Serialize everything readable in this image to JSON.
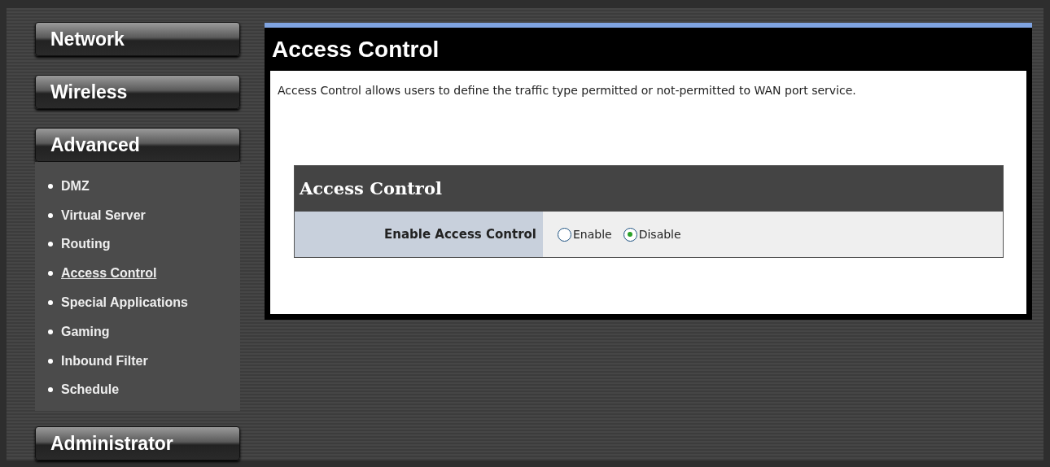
{
  "sidebar": {
    "sections": [
      {
        "label": "Network"
      },
      {
        "label": "Wireless"
      },
      {
        "label": "Advanced",
        "items": [
          {
            "label": "DMZ",
            "selected": false
          },
          {
            "label": "Virtual Server",
            "selected": false
          },
          {
            "label": "Routing",
            "selected": false
          },
          {
            "label": "Access Control",
            "selected": true
          },
          {
            "label": "Special Applications",
            "selected": false
          },
          {
            "label": "Gaming",
            "selected": false
          },
          {
            "label": "Inbound Filter",
            "selected": false
          },
          {
            "label": "Schedule",
            "selected": false
          }
        ]
      },
      {
        "label": "Administrator"
      }
    ]
  },
  "main": {
    "title": "Access Control",
    "description": "Access Control allows users to define the traffic type permitted or not-permitted to WAN port service.",
    "table": {
      "header": "Access Control",
      "rows": [
        {
          "label": "Enable Access Control",
          "options": [
            {
              "label": "Enable",
              "selected": false
            },
            {
              "label": "Disable",
              "selected": true
            }
          ]
        }
      ]
    }
  }
}
